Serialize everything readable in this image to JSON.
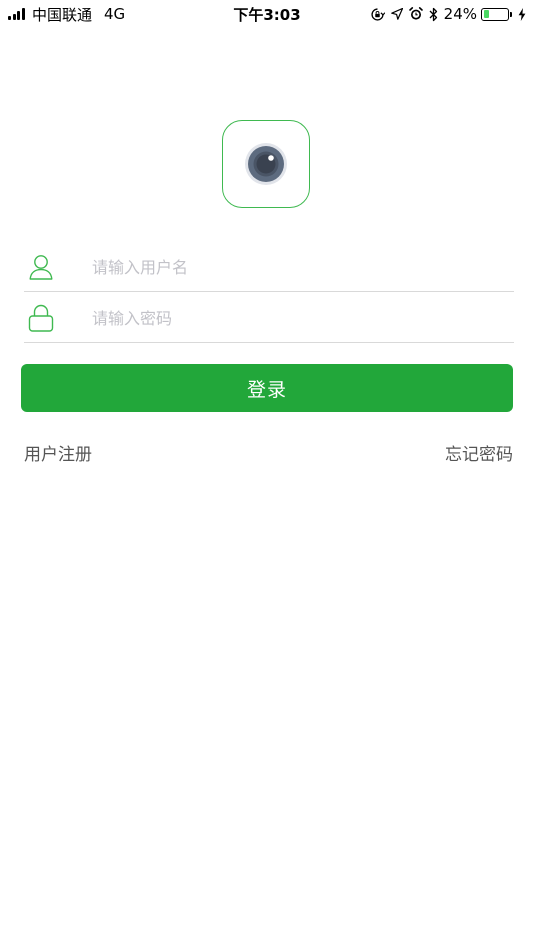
{
  "status_bar": {
    "carrier": "中国联通",
    "network": "4G",
    "time": "下午3:03",
    "battery_percent": "24%",
    "battery_level": 0.24,
    "icons": [
      "signal-icon",
      "orientation-lock-icon",
      "location-icon",
      "alarm-icon",
      "bluetooth-icon",
      "battery-icon",
      "charging-icon"
    ]
  },
  "logo": {
    "icon": "camera-lens-icon",
    "border_color": "#3fb950"
  },
  "form": {
    "username": {
      "icon": "user-icon",
      "placeholder": "请输入用户名",
      "value": ""
    },
    "password": {
      "icon": "lock-icon",
      "placeholder": "请输入密码",
      "value": ""
    },
    "login_label": "登录"
  },
  "links": {
    "register": "用户注册",
    "forgot_password": "忘记密码"
  },
  "colors": {
    "accent": "#22a73a",
    "icon_green": "#3fb950",
    "placeholder": "#c2c2c8",
    "divider": "#d9d9d9"
  }
}
